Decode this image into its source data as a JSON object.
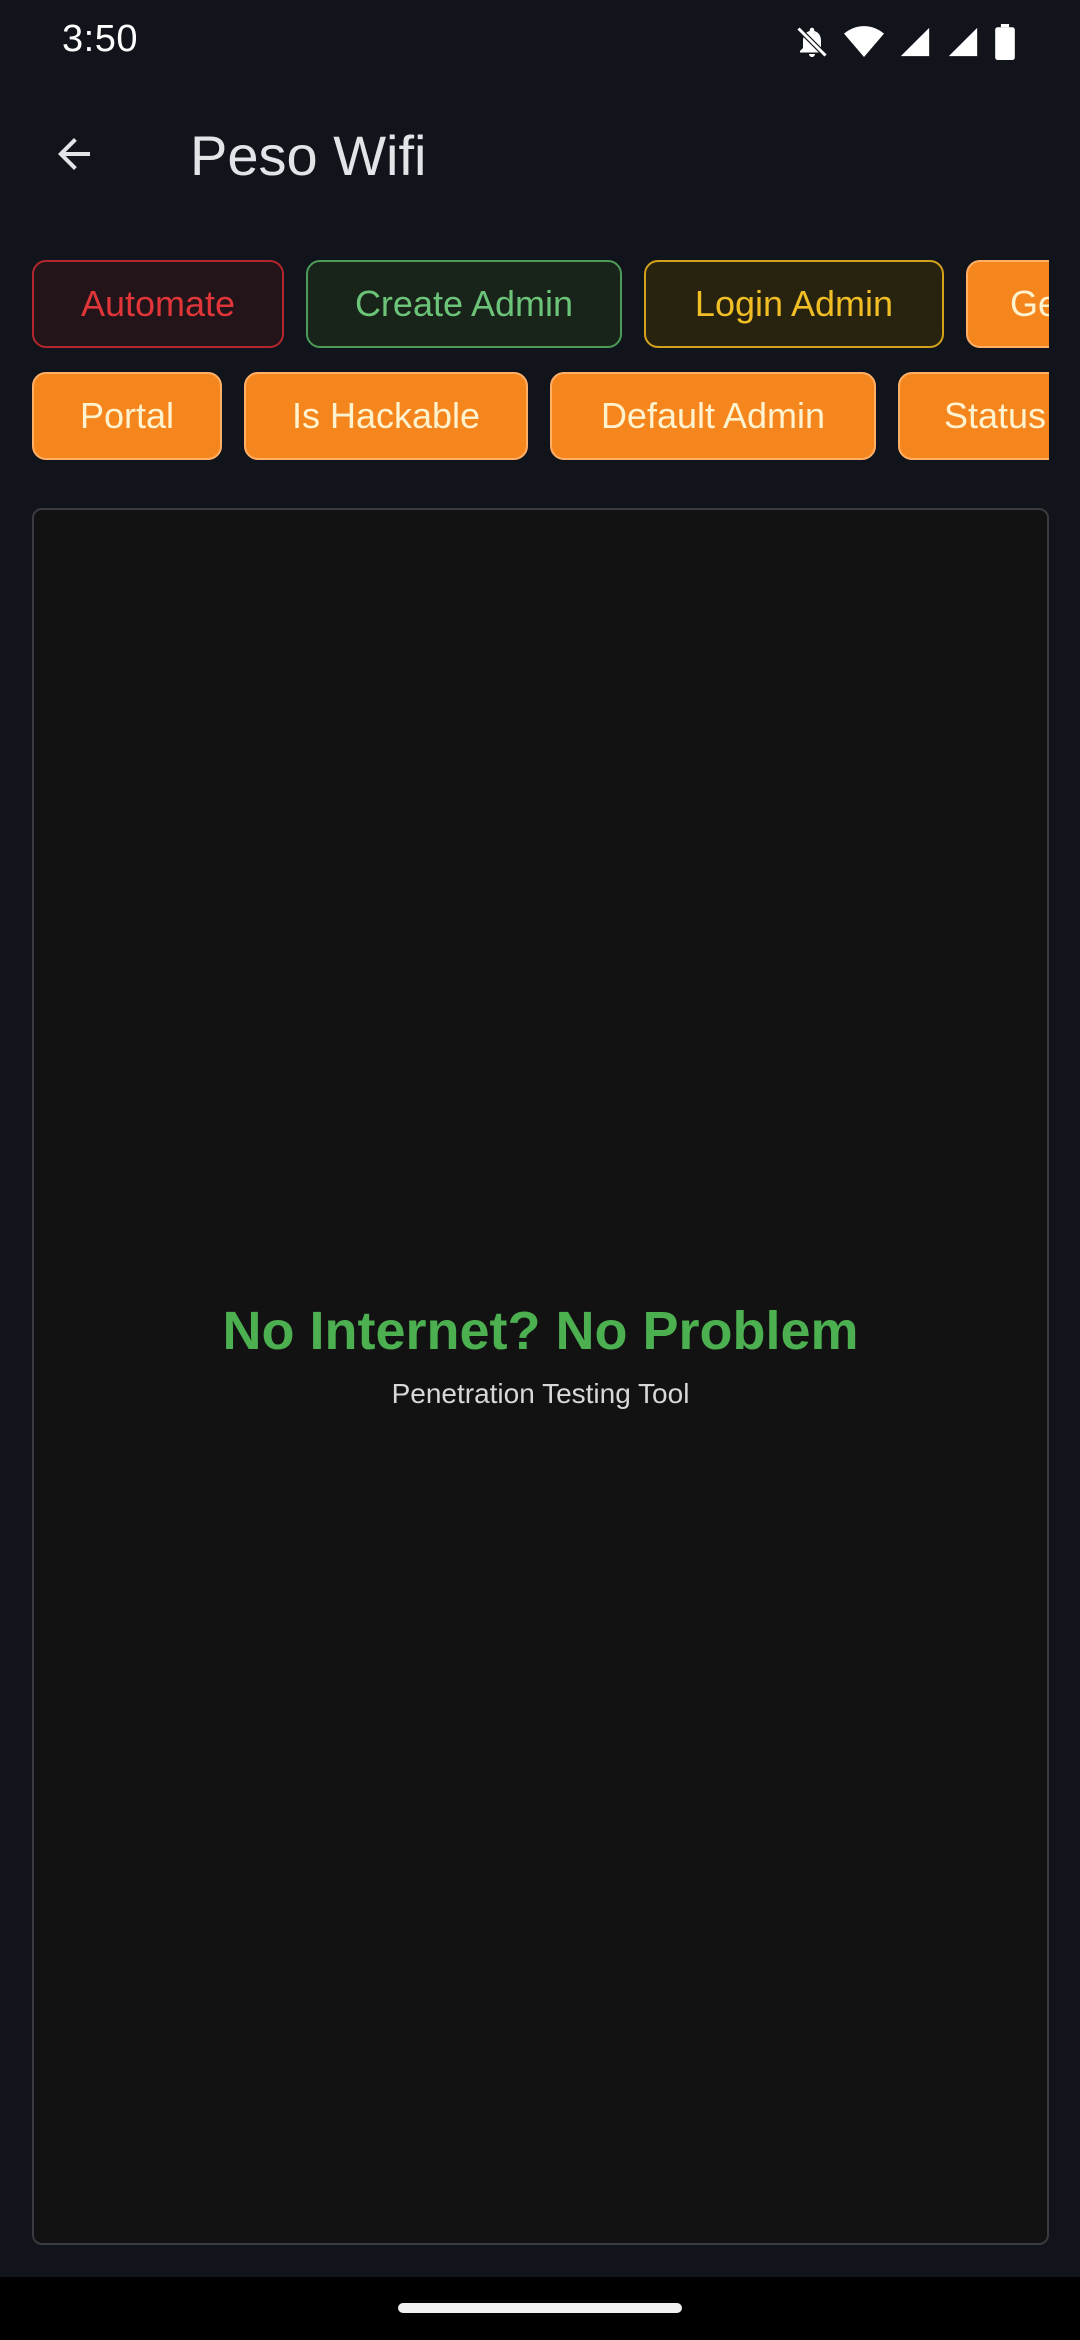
{
  "status_bar": {
    "time": "3:50",
    "icons": [
      "notifications-off-icon",
      "wifi-icon",
      "signal-icon",
      "signal-icon",
      "battery-icon"
    ]
  },
  "app_bar": {
    "back_icon": "arrow-back-icon",
    "title": "Peso Wifi"
  },
  "actions": {
    "row1": [
      {
        "label": "Automate",
        "color": "#e0363a"
      },
      {
        "label": "Create Admin",
        "color": "#6cc479"
      },
      {
        "label": "Login Admin",
        "color": "#f2be26"
      },
      {
        "label": "Ge",
        "color": "#f5861d"
      }
    ],
    "row2": [
      {
        "label": "Portal",
        "color": "#f5861d"
      },
      {
        "label": "Is Hackable",
        "color": "#f5861d"
      },
      {
        "label": "Default Admin",
        "color": "#f5861d"
      },
      {
        "label": "Status",
        "color": "#f5861d"
      }
    ]
  },
  "panel": {
    "headline": "No Internet? No Problem",
    "subtitle": "Penetration Testing Tool",
    "headline_color": "#4caf50"
  }
}
